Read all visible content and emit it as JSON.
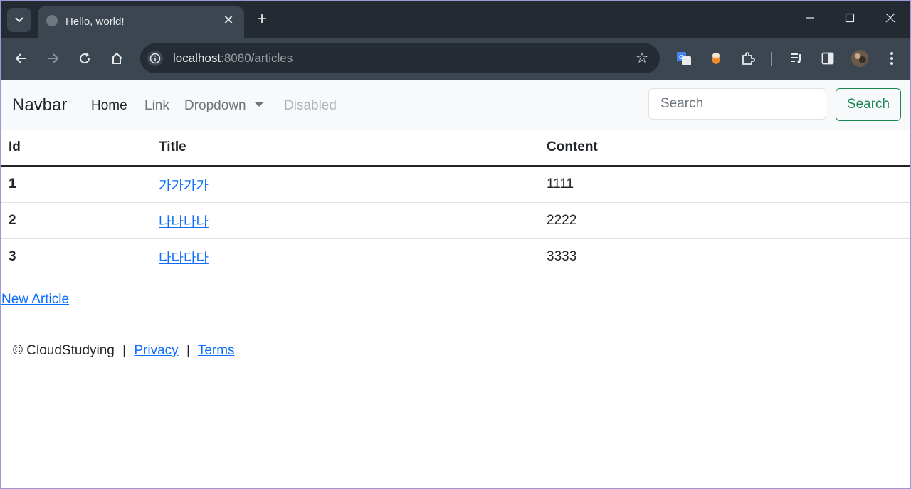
{
  "browser": {
    "tab_title": "Hello, world!",
    "tab_close": "✕",
    "new_tab": "+",
    "url_host": "localhost",
    "url_rest": ":8080/articles",
    "window": {
      "minimize": "—",
      "maximize": "☐",
      "close": "✕"
    }
  },
  "navbar": {
    "brand": "Navbar",
    "links": {
      "home": "Home",
      "link": "Link",
      "dropdown": "Dropdown",
      "disabled": "Disabled"
    },
    "search_placeholder": "Search",
    "search_button": "Search"
  },
  "table": {
    "headers": {
      "id": "Id",
      "title": "Title",
      "content": "Content"
    },
    "rows": [
      {
        "id": "1",
        "title": "가가가가",
        "content": "1111"
      },
      {
        "id": "2",
        "title": "나나나나",
        "content": "2222"
      },
      {
        "id": "3",
        "title": "다다다다",
        "content": "3333"
      }
    ]
  },
  "new_article": "New Article",
  "footer": {
    "copyright": "© CloudStudying",
    "divider": "|",
    "privacy": "Privacy",
    "terms": "Terms"
  },
  "colors": {
    "success": "#198754",
    "link": "#0d6efd",
    "navbar_bg": "#f8f9fa",
    "chrome_bg": "#3c4650"
  }
}
